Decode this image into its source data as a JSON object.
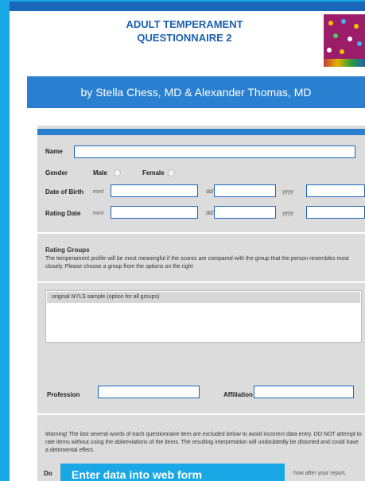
{
  "title_line1": "ADULT TEMPERAMENT",
  "title_line2": "QUESTIONNAIRE 2",
  "authors": "by Stella Chess, MD & Alexander Thomas, MD",
  "form": {
    "name_label": "Name",
    "gender_label": "Gender",
    "male_label": "Male",
    "female_label": "Female",
    "dob_label": "Date of Birth",
    "rating_date_label": "Rating Date",
    "dob_unit_month": "mm/",
    "dob_unit_day": "dd/",
    "dob_unit_year": "yyyy",
    "rd_unit_month": "mm/",
    "rd_unit_day": "dd/",
    "rd_unit_year": "yyyy"
  },
  "norms": {
    "heading": "Rating Groups",
    "text": "The temperament profile will be most meaningful if the scores are compared with the group that the person resembles most closely. Please choose a group from the options on the right",
    "selected_option": "original NYLS sample (option for all groups)"
  },
  "profession_label": "Profession",
  "affiliation_label": "Affiliation",
  "warning": "Warning! The last several words of each questionnaire item are excluded below to avoid incorrect data entry. DO NOT attempt to rate items without using the abbreviations of the items. The resulting interpretation will undoubtedly be distorted and could have a detrimental effect.",
  "partial_left": "Do",
  "partial_right": "how after your report.",
  "banner": "Enter data into web form"
}
